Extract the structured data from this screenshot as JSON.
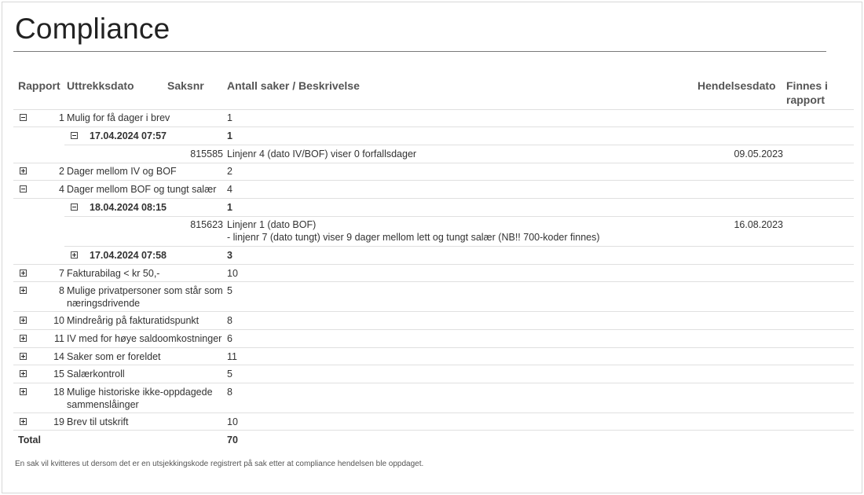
{
  "page": {
    "title": "Compliance",
    "footnote": "En sak vil kvitteres ut dersom det er en utsjekkingskode registrert på sak etter at compliance hendelsen ble oppdaget."
  },
  "table": {
    "headers": {
      "rapport": "Rapport",
      "uttrekksdato": "Uttrekksdato",
      "saksnr": "Saksnr",
      "beskrivelse": "Antall saker / Beskrivelse",
      "hendelsesdato": "Hendelsesdato",
      "finnes": "Finnes i rapport"
    },
    "rows": [
      {
        "id": "1",
        "label": "Mulig for få dager i brev",
        "count": "1",
        "expanded": true
      },
      {
        "date": "17.04.2024 07:57",
        "count": "1",
        "expanded": true
      },
      {
        "saksnr": "815585",
        "description": "Linjenr 4 (dato IV/BOF) viser 0 forfallsdager",
        "hendelsesdato": "09.05.2023"
      },
      {
        "id": "2",
        "label": "Dager mellom IV og BOF",
        "count": "2",
        "expanded": false
      },
      {
        "id": "4",
        "label": "Dager mellom BOF og tungt salær",
        "count": "4",
        "expanded": true
      },
      {
        "date": "18.04.2024 08:15",
        "count": "1",
        "expanded": true
      },
      {
        "saksnr": "815623",
        "description_line1": "Linjenr 1 (dato BOF)",
        "description_line2": "- linjenr 7 (dato tungt) viser 9 dager mellom lett og tungt salær (NB!! 700-koder finnes)",
        "hendelsesdato": "16.08.2023"
      },
      {
        "date": "17.04.2024 07:58",
        "count": "3",
        "expanded": false
      },
      {
        "id": "7",
        "label": "Fakturabilag < kr 50,-",
        "count": "10",
        "expanded": false
      },
      {
        "id": "8",
        "label_line1": "Mulige privatpersoner som står som",
        "label_line2": "næringsdrivende",
        "count": "5",
        "expanded": false
      },
      {
        "id": "10",
        "label": "Mindreårig på fakturatidspunkt",
        "count": "8",
        "expanded": false
      },
      {
        "id": "11",
        "label": "IV med for høye saldoomkostninger",
        "count": "6",
        "expanded": false
      },
      {
        "id": "14",
        "label": "Saker som er foreldet",
        "count": "11",
        "expanded": false
      },
      {
        "id": "15",
        "label": "Salærkontroll",
        "count": "5",
        "expanded": false
      },
      {
        "id": "18",
        "label_line1": "Mulige historiske ikke-oppdagede",
        "label_line2": "sammenslåinger",
        "count": "8",
        "expanded": false
      },
      {
        "id": "19",
        "label": "Brev til utskrift",
        "count": "10",
        "expanded": false
      }
    ],
    "total": {
      "label": "Total",
      "count": "70"
    }
  }
}
